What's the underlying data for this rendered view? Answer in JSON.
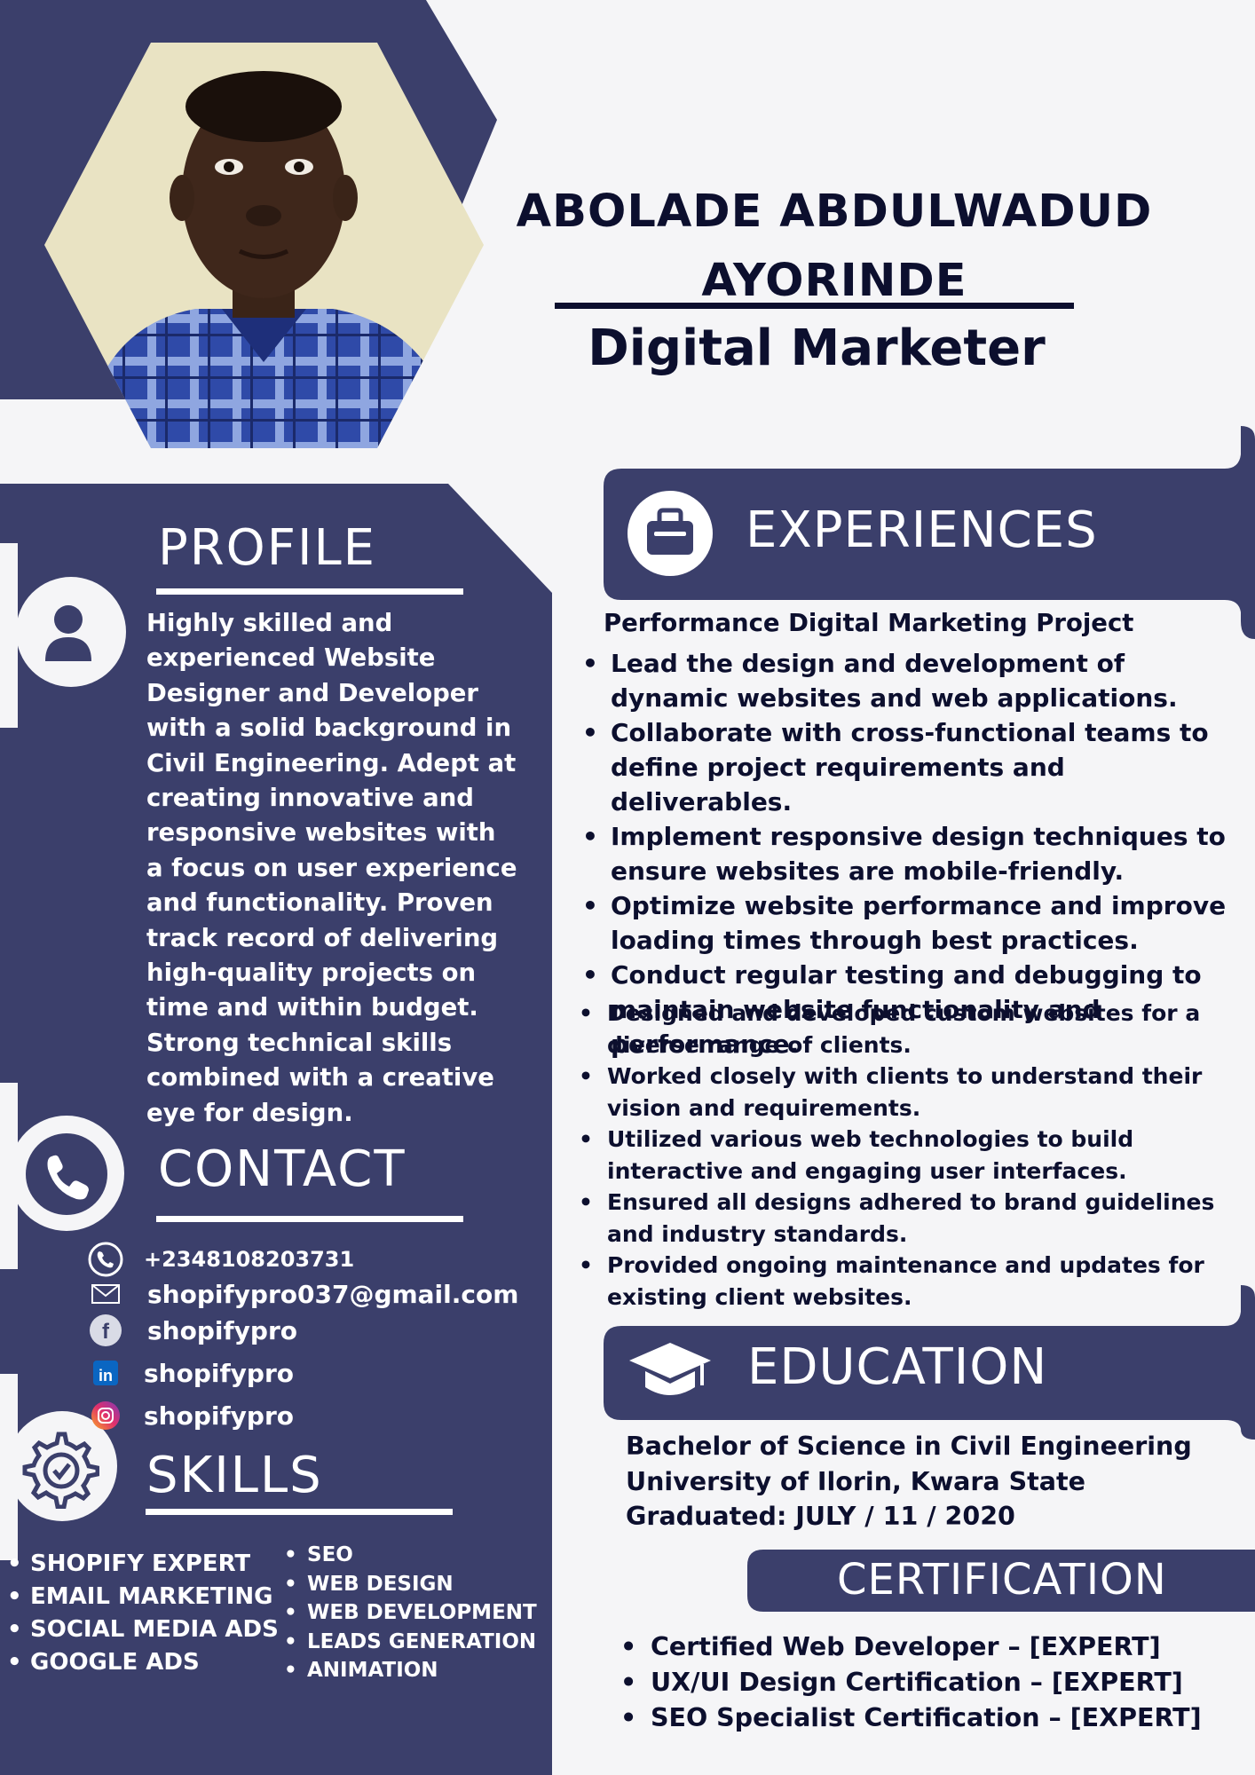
{
  "header": {
    "name_line1": "ABOLADE ABDULWADUD",
    "name_line2": "AYORINDE",
    "role": "Digital Marketer"
  },
  "profile": {
    "heading": "PROFILE",
    "text": "Highly skilled and experienced Website Designer and Developer with a solid background in Civil Engineering. Adept at creating innovative and responsive websites with a focus on user experience and functionality. Proven track record of delivering high-quality projects on time and within budget. Strong technical skills combined with a creative eye for design."
  },
  "contact": {
    "heading": "CONTACT",
    "items": [
      {
        "icon": "phone-icon",
        "value": "+2348108203731"
      },
      {
        "icon": "mail-icon",
        "value": "shopifypro037@gmail.com"
      },
      {
        "icon": "facebook-icon",
        "value": "shopifypro"
      },
      {
        "icon": "linkedin-icon",
        "value": "shopifypro"
      },
      {
        "icon": "instagram-icon",
        "value": "shopifypro"
      }
    ]
  },
  "skills": {
    "heading": "SKILLS",
    "col1": [
      "SHOPIFY EXPERT",
      "EMAIL MARKETING",
      "SOCIAL MEDIA ADS",
      "GOOGLE ADS"
    ],
    "col2": [
      "SEO",
      "WEB DESIGN",
      "WEB DEVELOPMENT",
      "LEADS GENERATION",
      "ANIMATION"
    ]
  },
  "experiences": {
    "heading": "EXPERIENCES",
    "subheading": "Performance Digital Marketing Project",
    "items_primary": [
      "Lead the design and development of dynamic websites and web applications.",
      "Collaborate with cross-functional teams to define project requirements and deliverables.",
      "Implement responsive design techniques to ensure websites are mobile-friendly.",
      "Optimize website performance and improve loading times through best practices.",
      "Conduct regular testing and debugging to maintain website functionality and performance."
    ],
    "items_secondary": [
      "Designed and developed custom websites for a diverse range of clients.",
      "Worked closely with clients to understand their vision and requirements.",
      "Utilized various web technologies to build interactive and engaging user interfaces.",
      "Ensured all designs adhered to brand guidelines and industry standards.",
      "Provided ongoing maintenance and updates for existing client websites."
    ]
  },
  "education": {
    "heading": "EDUCATION",
    "degree": "Bachelor of Science in Civil Engineering",
    "school": "University of Ilorin, Kwara State",
    "graduated": "Graduated: JULY / 11 / 2020"
  },
  "certification": {
    "heading": "CERTIFICATION",
    "items": [
      "Certified Web Developer – [EXPERT]",
      "UX/UI Design Certification – [EXPERT]",
      "SEO Specialist Certification – [EXPERT]"
    ]
  },
  "colors": {
    "navy": "#3b3f6b",
    "text_dark": "#0c0f2e",
    "background": "#f5f5f7"
  }
}
